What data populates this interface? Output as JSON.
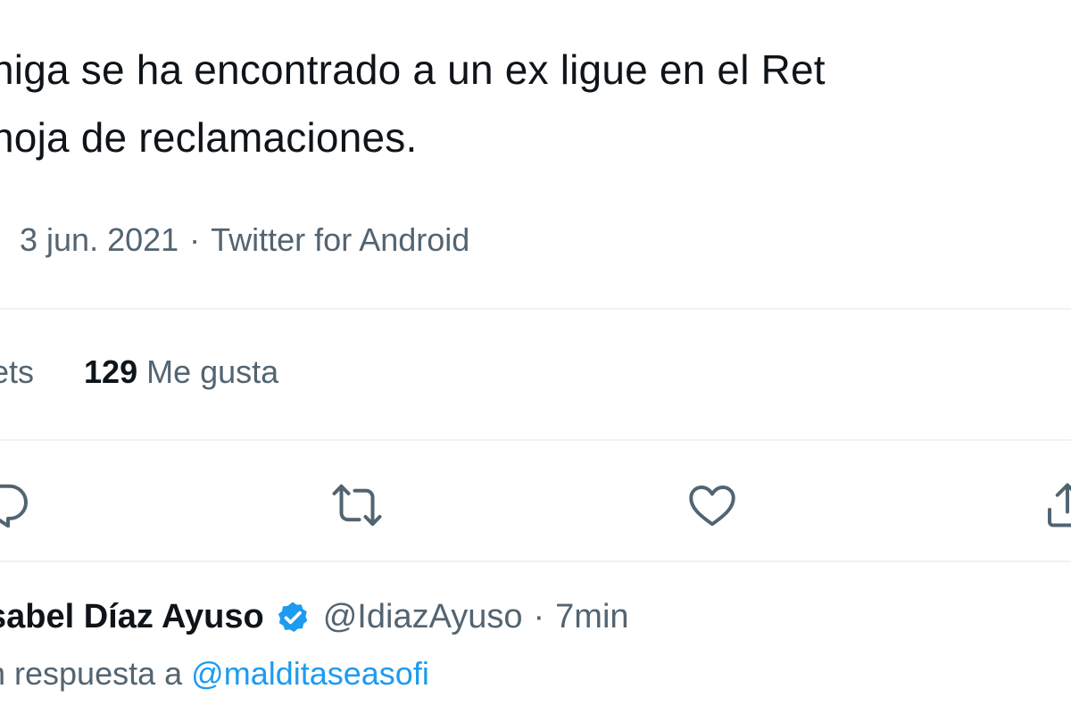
{
  "tweet": {
    "text_line_1": "niga se ha encontrado a un ex ligue en el Ret",
    "text_line_2": "hoja de reclamaciones.",
    "time_fragment": "·",
    "date": "3 jun. 2021",
    "separator": "·",
    "source": "Twitter for Android"
  },
  "stats": {
    "retweets_label": "ets",
    "likes_count": "129",
    "likes_label": "Me gusta"
  },
  "actions": {
    "reply_icon": "reply-icon",
    "retweet_icon": "retweet-icon",
    "like_icon": "heart-icon",
    "share_icon": "share-icon"
  },
  "reply": {
    "name": "sabel Díaz Ayuso",
    "handle": "@IdiazAyuso",
    "dot": "·",
    "time": "7min",
    "in_reply_to_label": "n respuesta a",
    "in_reply_to_handle": "@malditaseasofi"
  },
  "colors": {
    "text": "#0f1419",
    "secondary": "#536471",
    "accent": "#1d9bf0",
    "divider": "#eff3f4"
  }
}
